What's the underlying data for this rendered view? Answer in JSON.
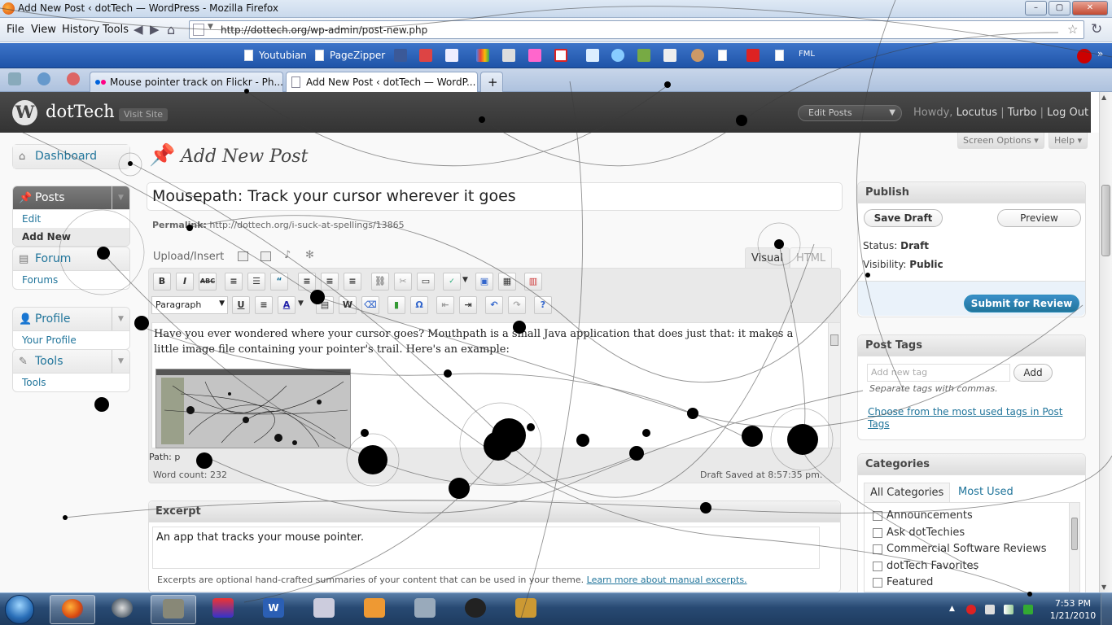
{
  "window": {
    "title": "Add New Post ‹ dotTech — WordPress - Mozilla Firefox"
  },
  "menu": [
    "File",
    "View",
    "History",
    "Tools"
  ],
  "url": "http://dottech.org/wp-admin/post-new.php",
  "bookmarks": [
    "Youtubian",
    "PageZipper",
    "FML"
  ],
  "tabs": [
    {
      "label": "Mouse pointer track on Flickr - Ph..."
    },
    {
      "label": "Add New Post ‹ dotTech — WordP..."
    }
  ],
  "new_tab": "+",
  "wp": {
    "site_name": "dotTech",
    "visit_site": "Visit Site",
    "edit_posts": "Edit Posts",
    "howdy": "Howdy,",
    "user": "Locutus",
    "turbo": "Turbo",
    "logout": "Log Out",
    "sep": "|",
    "screen_options": "Screen Options",
    "help": "Help"
  },
  "sidebar": {
    "dashboard": "Dashboard",
    "posts": "Posts",
    "posts_sub": [
      "Edit",
      "Add New"
    ],
    "forum": "Forum",
    "forum_sub": [
      "Forums"
    ],
    "profile": "Profile",
    "profile_sub": [
      "Your Profile"
    ],
    "tools": "Tools",
    "tools_sub": [
      "Tools"
    ]
  },
  "page_title": "Add New Post",
  "post": {
    "title": "Mousepath:  Track your cursor wherever it goes",
    "permalink_label": "Permalink:",
    "permalink": "http://dottech.org/i-suck-at-spellings/13865",
    "upload_insert": "Upload/Insert",
    "tab_visual": "Visual",
    "tab_html": "HTML",
    "format": "Paragraph",
    "body": "Have you ever wondered where your cursor goes?  Mouthpath is a small Java application that does just that:  it makes a little image file containing your pointer's trail.  Here's an example:",
    "path": "Path: p",
    "word_count": "Word count: 232",
    "draft_saved": "Draft Saved at 8:57:35 pm."
  },
  "excerpt": {
    "heading": "Excerpt",
    "text": "An app that tracks your mouse pointer.",
    "help": "Excerpts are optional hand-crafted summaries of your content that can be used in your theme.",
    "help_link": "Learn more about manual excerpts."
  },
  "publish": {
    "heading": "Publish",
    "save_draft": "Save Draft",
    "preview": "Preview",
    "status_label": "Status:",
    "status": "Draft",
    "visibility_label": "Visibility:",
    "visibility": "Public",
    "submit": "Submit for Review"
  },
  "tags": {
    "heading": "Post Tags",
    "placeholder": "Add new tag",
    "add": "Add",
    "hint": "Separate tags with commas.",
    "link": "Choose from the most used tags in Post Tags"
  },
  "categories": {
    "heading": "Categories",
    "tab_all": "All Categories",
    "tab_most": "Most Used",
    "items": [
      "Announcements",
      "Ask dotTechies",
      "Commercial Software Reviews",
      "dotTech Favorites",
      "Featured"
    ]
  },
  "clock": {
    "time": "7:53 PM",
    "date": "1/21/2010"
  },
  "colors": {
    "wp_link": "#21759b",
    "wp_header": "#464646",
    "taskbar": "#284a73",
    "submit": "#21759b"
  }
}
